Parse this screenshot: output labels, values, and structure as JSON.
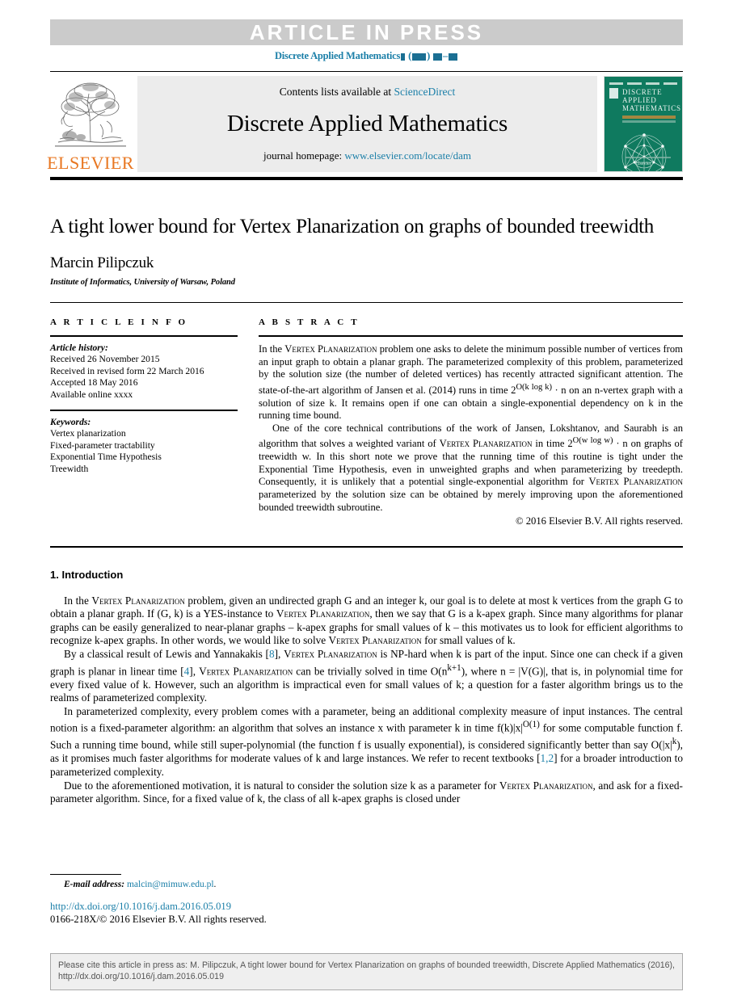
{
  "banner": {
    "text": "ARTICLE IN PRESS",
    "journal_ref_prefix": "Discrete Applied Mathematics"
  },
  "masthead": {
    "contents_prefix": "Contents lists available at",
    "sciencedirect": "ScienceDirect",
    "journal_title": "Discrete Applied Mathematics",
    "homepage_prefix": "journal homepage:",
    "homepage_url": "www.elsevier.com/locate/dam",
    "publisher": "ELSEVIER",
    "cover_title_line1": "DISCRETE",
    "cover_title_line2": "APPLIED",
    "cover_title_line3": "MATHEMATICS",
    "cover_footer": "Elsevier"
  },
  "article": {
    "title": "A tight lower bound for Vertex Planarization on graphs of bounded treewidth",
    "author": "Marcin Pilipczuk",
    "affiliation": "Institute of Informatics, University of Warsaw, Poland"
  },
  "info": {
    "heading": "A R T I C L E   I N F O",
    "history_label": "Article history:",
    "history": [
      "Received 26 November 2015",
      "Received in revised form 22 March 2016",
      "Accepted 18 May 2016",
      "Available online xxxx"
    ],
    "keywords_label": "Keywords:",
    "keywords": [
      "Vertex planarization",
      "Fixed-parameter tractability",
      "Exponential Time Hypothesis",
      "Treewidth"
    ]
  },
  "abstract": {
    "heading": "A B S T R A C T",
    "paragraph1_a": "In the ",
    "paragraph1_sc1": "Vertex Planarization",
    "paragraph1_b": " problem one asks to delete the minimum possible number of vertices from an input graph to obtain a planar graph. The parameterized complexity of this problem, parameterized by the solution size (the number of deleted vertices) has recently attracted significant attention. The state-of-the-art algorithm of Jansen et al. (2014) runs in time 2",
    "paragraph1_exp1": "O(k log k)",
    "paragraph1_c": " · n on an n-vertex graph with a solution of size k. It remains open if one can obtain a single-exponential dependency on k in the running time bound.",
    "paragraph2_a": "One of the core technical contributions of the work of Jansen, Lokshtanov, and Saurabh is an algorithm that solves a weighted variant of ",
    "paragraph2_sc1": "Vertex Planarization",
    "paragraph2_b": " in time 2",
    "paragraph2_exp1": "O(w log w)",
    "paragraph2_c": " · n on graphs of treewidth w. In this short note we prove that the running time of this routine is tight under the Exponential Time Hypothesis, even in unweighted graphs and when parameterizing by treedepth. Consequently, it is unlikely that a potential single-exponential algorithm for ",
    "paragraph2_sc2": "Vertex Planarization",
    "paragraph2_d": " parameterized by the solution size can be obtained by merely improving upon the aforementioned bounded treewidth subroutine.",
    "copyright": "© 2016 Elsevier B.V. All rights reserved."
  },
  "introduction": {
    "heading": "1. Introduction",
    "p1_a": "In the ",
    "p1_sc1": "Vertex Planarization",
    "p1_b": " problem, given an undirected graph G and an integer k, our goal is to delete at most k vertices from the graph G to obtain a planar graph. If (G, k) is a YES-instance to ",
    "p1_sc2": "Vertex Planarization",
    "p1_c": ", then we say that G is a k-apex graph. Since many algorithms for planar graphs can be easily generalized to near-planar graphs – k-apex graphs for small values of k – this motivates us to look for efficient algorithms to recognize k-apex graphs. In other words, we would like to solve ",
    "p1_sc3": "Vertex Planarization",
    "p1_d": " for small values of k.",
    "p2_a": "By a classical result of Lewis and Yannakakis [",
    "p2_ref1": "8",
    "p2_b": "], ",
    "p2_sc1": "Vertex Planarization",
    "p2_c": " is NP-hard when k is part of the input. Since one can check if a given graph is planar in linear time [",
    "p2_ref2": "4",
    "p2_d": "], ",
    "p2_sc2": "Vertex Planarization",
    "p2_e": " can be trivially solved in time O(n",
    "p2_exp": "k+1",
    "p2_f": "), where n = |V(G)|, that is, in polynomial time for every fixed value of k. However, such an algorithm is impractical even for small values of k; a question for a faster algorithm brings us to the realms of parameterized complexity.",
    "p3_a": "In parameterized complexity, every problem comes with a parameter, being an additional complexity measure of input instances. The central notion is a fixed-parameter algorithm: an algorithm that solves an instance x with parameter k in time f(k)|x|",
    "p3_exp1": "O(1)",
    "p3_b": " for some computable function f. Such a running time bound, while still super-polynomial (the function f is usually exponential), is considered significantly better than say O(|x|",
    "p3_exp2": "k",
    "p3_c": "), as it promises much faster algorithms for moderate values of k and large instances. We refer to recent textbooks [",
    "p3_ref": "1,2",
    "p3_d": "] for a broader introduction to parameterized complexity.",
    "p4_a": "Due to the aforementioned motivation, it is natural to consider the solution size k as a parameter for ",
    "p4_sc1": "Vertex Planarization",
    "p4_b": ", and ask for a fixed-parameter algorithm. Since, for a fixed value of k, the class of all k-apex graphs is closed under"
  },
  "footer": {
    "email_label": "E-mail address:",
    "email": "malcin@mimuw.edu.pl",
    "email_suffix": ".",
    "doi": "http://dx.doi.org/10.1016/j.dam.2016.05.019",
    "issn": "0166-218X/© 2016 Elsevier B.V. All rights reserved."
  },
  "cite_box": {
    "text": "Please cite this article in press as: M. Pilipczuk, A tight lower bound for Vertex Planarization on graphs of bounded treewidth, Discrete Applied Mathematics (2016), http://dx.doi.org/10.1016/j.dam.2016.05.019"
  },
  "colors": {
    "link": "#1b7fa8",
    "banner_bg": "#cbcbcb",
    "masthead_bg": "#ececec",
    "elsevier_orange": "#E87722",
    "cover_green": "#0f7a5f"
  }
}
